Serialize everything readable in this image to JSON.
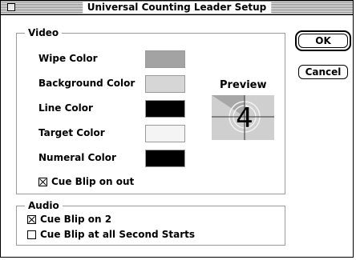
{
  "window": {
    "title": "Universal Counting Leader Setup"
  },
  "buttons": {
    "ok": "OK",
    "cancel": "Cancel"
  },
  "video": {
    "legend": "Video",
    "rows": [
      {
        "label": "Wipe Color",
        "color": "#a3a3a3"
      },
      {
        "label": "Background Color",
        "color": "#d6d6d6"
      },
      {
        "label": "Line Color",
        "color": "#000000"
      },
      {
        "label": "Target Color",
        "color": "#f4f4f4"
      },
      {
        "label": "Numeral Color",
        "color": "#000000"
      }
    ],
    "cue_blip_out": {
      "label": "Cue Blip on out",
      "checked": true
    },
    "preview": {
      "label": "Preview",
      "numeral": "4"
    }
  },
  "audio": {
    "legend": "Audio",
    "cue_blip_2": {
      "label": "Cue Blip on 2",
      "checked": true
    },
    "cue_blip_all": {
      "label": "Cue Blip at all Second Starts",
      "checked": false
    }
  }
}
